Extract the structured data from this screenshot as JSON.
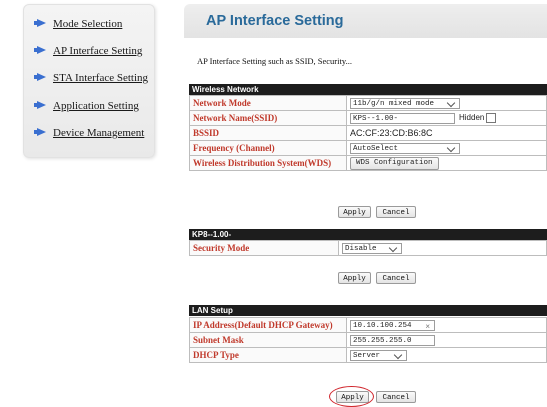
{
  "sidebar": {
    "items": [
      {
        "label": "Mode Selection"
      },
      {
        "label": "AP Interface Setting"
      },
      {
        "label": "STA Interface Setting"
      },
      {
        "label": "Application Setting"
      },
      {
        "label": "Device Management"
      }
    ],
    "colors": {
      "arrow": "#3a6fd0"
    }
  },
  "header": {
    "title": "AP Interface Setting",
    "description": "AP Interface Setting such as SSID, Security..."
  },
  "wireless": {
    "section_title": "Wireless Network",
    "rows": [
      {
        "label": "Network Mode",
        "value": "11b/g/n mixed mode"
      },
      {
        "label": "Network Name(SSID)",
        "value": "KPS--1.00-",
        "hidden_label": "Hidden"
      },
      {
        "label": "BSSID",
        "value": "AC:CF:23:CD:B6:8C"
      },
      {
        "label": "Frequency (Channel)",
        "value": "AutoSelect"
      },
      {
        "label": "Wireless Distribution System(WDS)",
        "value": "WDS Configuration"
      }
    ],
    "apply": "Apply",
    "cancel": "Cancel"
  },
  "security": {
    "section_title": "KP8--1.00-",
    "rows": [
      {
        "label": "Security Mode",
        "value": "Disable"
      }
    ],
    "apply": "Apply",
    "cancel": "Cancel"
  },
  "lan": {
    "section_title": "LAN Setup",
    "rows": [
      {
        "label": "IP Address(Default DHCP Gateway)",
        "value": "10.10.100.254"
      },
      {
        "label": "Subnet Mask",
        "value": "255.255.255.0"
      },
      {
        "label": "DHCP Type",
        "value": "Server"
      }
    ],
    "apply": "Apply",
    "cancel": "Cancel"
  },
  "colors": {
    "label_red": "#c0392b",
    "title_blue": "#2a6a9a",
    "section_bar": "#1d1d1d",
    "highlight_ring": "#d0242b"
  }
}
